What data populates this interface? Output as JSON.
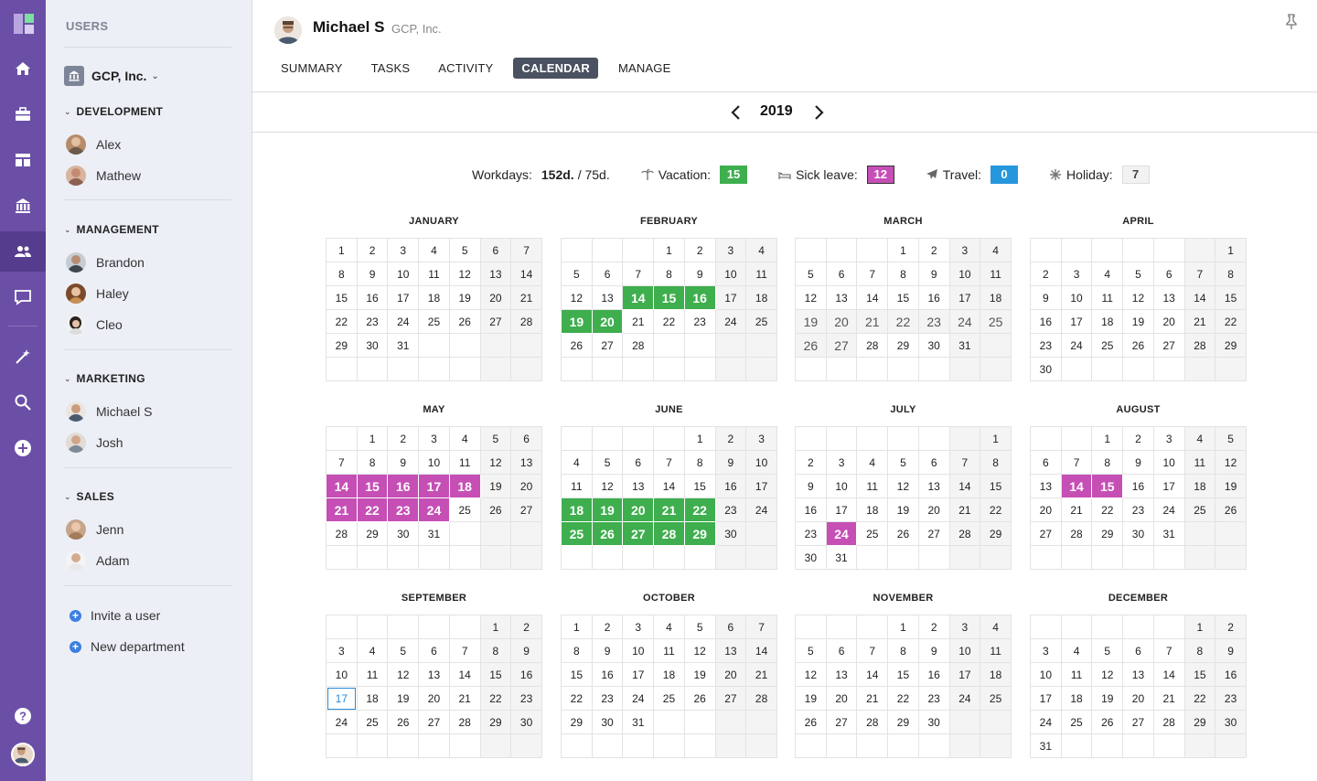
{
  "rail": {
    "items": [
      {
        "name": "home-icon"
      },
      {
        "name": "briefcase-icon"
      },
      {
        "name": "dashboard-icon"
      },
      {
        "name": "bank-icon"
      },
      {
        "name": "users-icon"
      },
      {
        "name": "chat-icon"
      },
      {
        "name": "magic-wand-icon"
      },
      {
        "name": "search-icon"
      },
      {
        "name": "add-icon"
      },
      {
        "name": "help-icon"
      }
    ]
  },
  "sidebar": {
    "title": "USERS",
    "org": "GCP, Inc.",
    "departments": [
      {
        "name": "DEVELOPMENT",
        "members": [
          "Alex",
          "Mathew"
        ]
      },
      {
        "name": "MANAGEMENT",
        "members": [
          "Brandon",
          "Haley",
          "Cleo"
        ]
      },
      {
        "name": "MARKETING",
        "members": [
          "Michael S",
          "Josh"
        ]
      },
      {
        "name": "SALES",
        "members": [
          "Jenn",
          "Adam"
        ]
      }
    ],
    "actions": [
      "Invite a user",
      "New department"
    ]
  },
  "profile": {
    "name": "Michael S",
    "org": "GCP, Inc."
  },
  "tabs": [
    "SUMMARY",
    "TASKS",
    "ACTIVITY",
    "CALENDAR",
    "MANAGE"
  ],
  "active_tab": "CALENDAR",
  "year": "2019",
  "stats": {
    "workdays_label": "Workdays:",
    "workdays_value": "152d.",
    "workdays_extra": "/ 75d.",
    "vacation_label": "Vacation:",
    "vacation_value": "15",
    "sick_label": "Sick leave:",
    "sick_value": "12",
    "travel_label": "Travel:",
    "travel_value": "0",
    "holiday_label": "Holiday:",
    "holiday_value": "7"
  },
  "colors": {
    "vacation": "#3fae4e",
    "sick": "#c64fb6",
    "travel": "#2797dd",
    "accent": "#6b4fa6"
  },
  "months": [
    {
      "name": "JANUARY",
      "days": 31,
      "offset": 0
    },
    {
      "name": "FEBRUARY",
      "days": 28,
      "offset": 3,
      "vacation": [
        14,
        15,
        16,
        19,
        20
      ]
    },
    {
      "name": "MARCH",
      "days": 31,
      "offset": 3,
      "holiday": [
        19,
        20,
        21,
        22,
        23,
        24,
        25,
        26,
        27
      ]
    },
    {
      "name": "APRIL",
      "days": 30,
      "offset": 6
    },
    {
      "name": "MAY",
      "days": 31,
      "offset": 1,
      "sick": [
        14,
        15,
        16,
        17,
        18,
        21,
        22,
        23,
        24
      ]
    },
    {
      "name": "JUNE",
      "days": 30,
      "offset": 4,
      "vacation": [
        18,
        19,
        20,
        21,
        22,
        25,
        26,
        27,
        28,
        29
      ]
    },
    {
      "name": "JULY",
      "days": 31,
      "offset": 6,
      "sick": [
        24
      ]
    },
    {
      "name": "AUGUST",
      "days": 31,
      "offset": 2,
      "sick": [
        14,
        15
      ]
    },
    {
      "name": "SEPTEMBER",
      "days": 30,
      "offset": 5,
      "today": 17
    },
    {
      "name": "OCTOBER",
      "days": 31,
      "offset": 0
    },
    {
      "name": "NOVEMBER",
      "days": 30,
      "offset": 3
    },
    {
      "name": "DECEMBER",
      "days": 31,
      "offset": 5
    }
  ]
}
